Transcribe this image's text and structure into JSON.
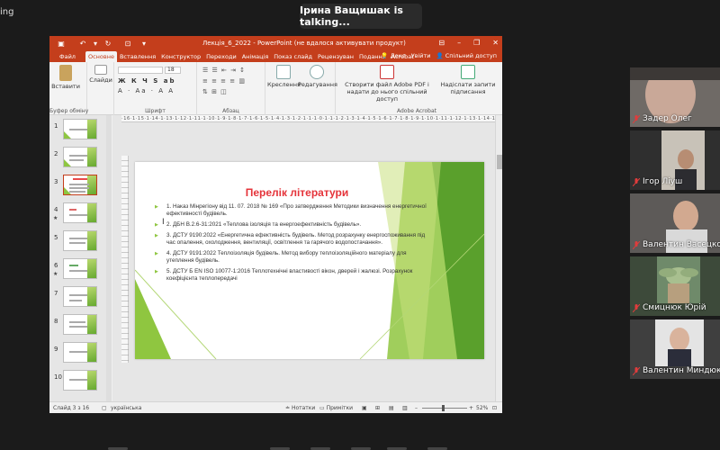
{
  "zoom": {
    "top_left_text": "ing",
    "speaker": "Ірина Ващишак is talking..."
  },
  "ppt": {
    "window_title": "Лекція_6_2022  -  PowerPoint (не вдалося активувати продукт)",
    "tabs": [
      "Файл",
      "Основне",
      "Вставлення",
      "Конструктор",
      "Переходи",
      "Анімація",
      "Показ слайд",
      "Рецензуван",
      "Подання",
      "Acrobat"
    ],
    "active_tab": "Основне",
    "tab_extras": {
      "tell_me": "Докл",
      "signin": "Увійти",
      "share": "Спільний доступ"
    },
    "ribbon": {
      "paste": "Вставити",
      "slides": "Слайди",
      "clipboard_group": "Буфер обміну",
      "font_group": "Шрифт",
      "paragraph_group": "Абзац",
      "font_size": "18",
      "drawing": "Креслення",
      "editing": "Редагування",
      "create_pdf": "Створити файл Adobe PDF і надати до нього спільний доступ",
      "request_sign": "Надіслати запити підписання",
      "acrobat_group": "Adobe Acrobat"
    },
    "ruler_text": "·16·1·15·1·14·1·13·1·12·1·11·1·10·1·9·1·8·1·7·1·6·1·5·1·4·1·3·1·2·1·1·1·0·1·1·1·2·1·3·1·4·1·5·1·6·1·7·1·8·1·9·1·10·1·11·1·12·1·13·1·14·1·15·1·16·",
    "thumbnails": [
      {
        "num": "1",
        "star": ""
      },
      {
        "num": "2",
        "star": ""
      },
      {
        "num": "3",
        "star": ""
      },
      {
        "num": "4",
        "star": "★"
      },
      {
        "num": "5",
        "star": ""
      },
      {
        "num": "6",
        "star": "★"
      },
      {
        "num": "7",
        "star": ""
      },
      {
        "num": "8",
        "star": ""
      },
      {
        "num": "9",
        "star": ""
      },
      {
        "num": "10",
        "star": ""
      }
    ],
    "slide": {
      "title": "Перелік літератури",
      "bullets": [
        "1. Наказ Мінрегіону від 11. 07. 2018 № 169 «Про затвердження Методики визначення енергетичної ефективності будівель.",
        "2. ДБН В.2.6-31:2021 «Теплова ізоляція та енергоефективність будівель».",
        "3. ДСТУ 9190:2022 «Енергетична ефективність будівель. Метод розрахунку енергоспоживання під час опалення, охолодження, вентиляції, освітлення та гарячого водопостачання».",
        "4. ДСТУ 9191:2022 Теплоізоляція будівель. Метод вибору теплоізоляційного матеріалу для утеплення будівель.",
        "5. ДСТУ Б EN ISO 10077-1:2016 Теплотехнічні властивості вікон, дверей і жалюзі. Розрахунок коефіцієнта теплопередачі"
      ]
    },
    "status": {
      "slide_of": "Слайд 3 з 16",
      "language": "українська",
      "notes": "Нотатки",
      "comments": "Примітки",
      "zoom": "52%"
    }
  },
  "participants": [
    {
      "name": "Задер Олег"
    },
    {
      "name": "Ігор Ліуш"
    },
    {
      "name": "Валентин Васецко"
    },
    {
      "name": "Смицнюк Юрій"
    },
    {
      "name": "Валентин Миндюк"
    }
  ],
  "colors": {
    "ppt_accent": "#c43e1c",
    "slide_title": "#e5333a",
    "slide_green": "#8fc640",
    "muted_mic": "#e03c3c"
  }
}
